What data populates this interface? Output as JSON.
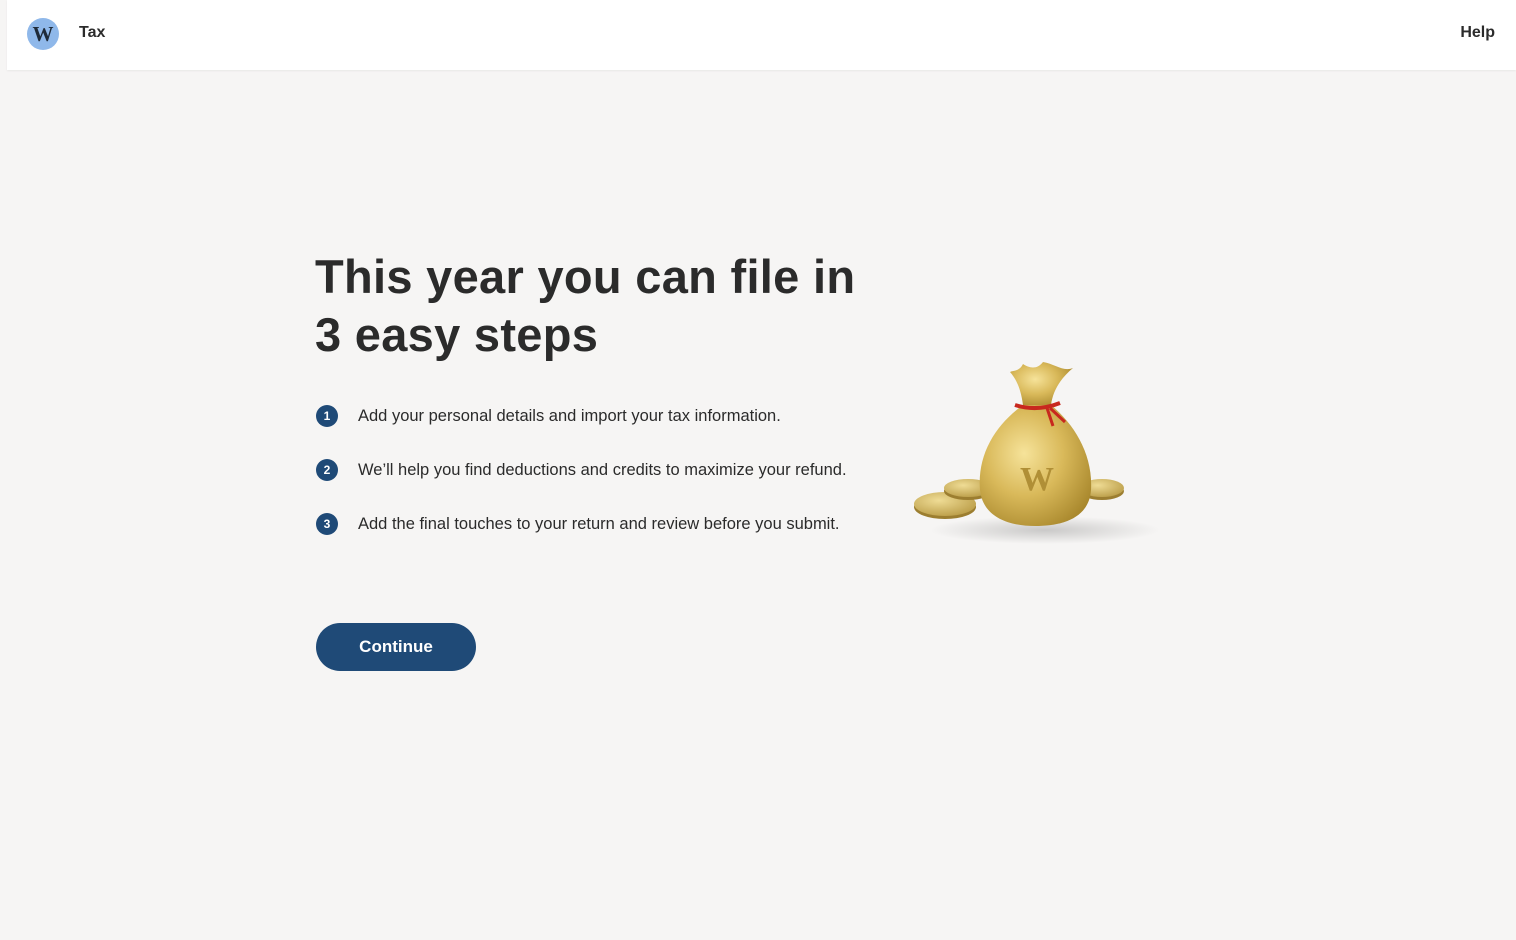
{
  "header": {
    "logo_letter": "W",
    "app_title": "Tax",
    "help_label": "Help"
  },
  "main": {
    "headline": "This year you can file in 3 easy steps",
    "steps": [
      {
        "number": "1",
        "text": "Add your personal details and import your tax information."
      },
      {
        "number": "2",
        "text": "We’ll help you find deductions and credits to maximize your refund."
      },
      {
        "number": "3",
        "text": "Add the final touches to your return and review before you submit."
      }
    ],
    "continue_label": "Continue"
  },
  "illustration": {
    "icon": "money-bag-with-coins-icon",
    "mark": "W"
  },
  "colors": {
    "background": "#f6f5f4",
    "header_bg": "#ffffff",
    "primary": "#1f4a77",
    "logo_bg": "#8fb8ea",
    "text": "#2b2b2b",
    "gold": "#d9b95a",
    "ribbon": "#c8281e"
  }
}
